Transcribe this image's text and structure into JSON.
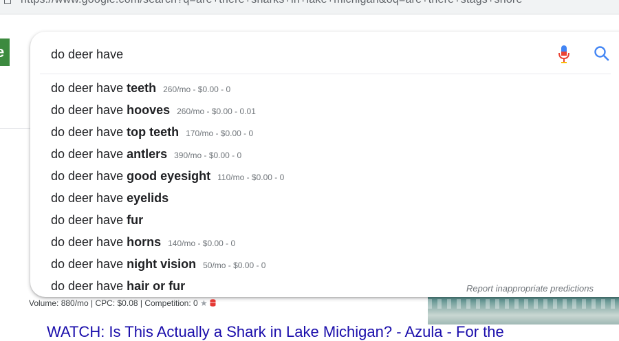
{
  "browser": {
    "url": "https://www.google.com/search?q=are+there+sharks+in+lake+michigan&oq=are+there+stags+shore"
  },
  "search": {
    "query": "do deer have",
    "suggestions": [
      {
        "prefix": "do deer have ",
        "completion": "teeth",
        "meta": "260/mo - $0.00 - 0"
      },
      {
        "prefix": "do deer have ",
        "completion": "hooves",
        "meta": "260/mo - $0.00 - 0.01"
      },
      {
        "prefix": "do deer have ",
        "completion": "top teeth",
        "meta": "170/mo - $0.00 - 0"
      },
      {
        "prefix": "do deer have ",
        "completion": "antlers",
        "meta": "390/mo - $0.00 - 0"
      },
      {
        "prefix": "do deer have ",
        "completion": "good eyesight",
        "meta": "110/mo - $0.00 - 0"
      },
      {
        "prefix": "do deer have ",
        "completion": "eyelids",
        "meta": ""
      },
      {
        "prefix": "do deer have ",
        "completion": "fur",
        "meta": ""
      },
      {
        "prefix": "do deer have ",
        "completion": "horns",
        "meta": "140/mo - $0.00 - 0"
      },
      {
        "prefix": "do deer have ",
        "completion": "night vision",
        "meta": "50/mo - $0.00 - 0"
      },
      {
        "prefix": "do deer have ",
        "completion": "hair or fur",
        "meta": ""
      }
    ],
    "report_link": "Report inappropriate predictions"
  },
  "results": {
    "volume_line": "Volume: 880/mo | CPC: $0.08 | Competition: 0",
    "first_title": "WATCH: Is This Actually a Shark in Lake Michigan? - Azula - For the"
  },
  "colors": {
    "link": "#1a0dab",
    "mic_red": "#ea4335",
    "mic_blue": "#4285f4",
    "search_blue": "#4285f4",
    "logo_green": "#3c8a3f"
  },
  "icons": {
    "mic": "microphone-icon",
    "search": "search-icon",
    "star": "star-icon",
    "database": "database-icon"
  }
}
